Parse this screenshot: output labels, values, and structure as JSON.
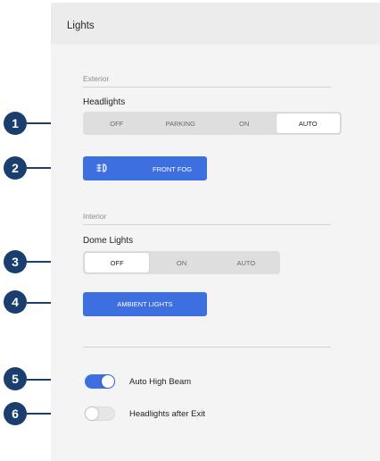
{
  "panel": {
    "title": "Lights"
  },
  "exterior": {
    "section_label": "Exterior",
    "headlights": {
      "title": "Headlights",
      "options": [
        "OFF",
        "PARKING",
        "ON",
        "AUTO"
      ],
      "selected": "AUTO"
    },
    "front_fog": {
      "label": "FRONT FOG",
      "icon": "front-fog-icon",
      "active": true
    }
  },
  "interior": {
    "section_label": "Interior",
    "dome_lights": {
      "title": "Dome Lights",
      "options": [
        "OFF",
        "ON",
        "AUTO"
      ],
      "selected": "OFF"
    },
    "ambient": {
      "label": "AMBIENT LIGHTS",
      "active": true
    }
  },
  "toggles": {
    "auto_high_beam": {
      "label": "Auto High Beam",
      "on": true
    },
    "headlights_after_exit": {
      "label": "Headlights after Exit",
      "on": false
    }
  },
  "callouts": [
    "1",
    "2",
    "3",
    "4",
    "5",
    "6"
  ],
  "colors": {
    "accent": "#3d6fe0",
    "callout": "#1a3e6e",
    "panel_bg": "#f4f4f4",
    "header_bg": "#ececec"
  }
}
